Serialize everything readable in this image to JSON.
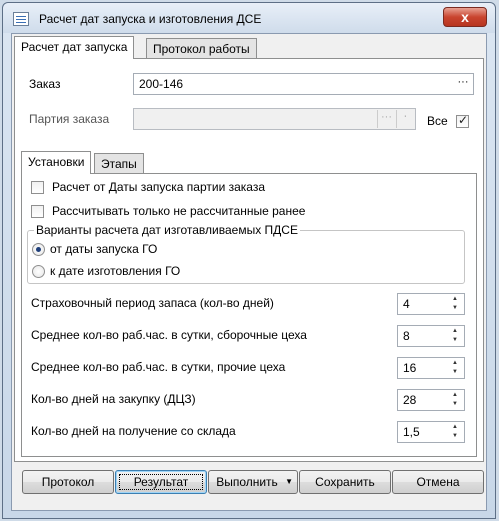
{
  "window": {
    "title": "Расчет дат запуска и изготовления ДСЕ",
    "close_glyph": "x"
  },
  "main_tabs": [
    {
      "label": "Расчет дат запуска",
      "active": true
    },
    {
      "label": "Протокол работы",
      "active": false
    }
  ],
  "order": {
    "label": "Заказ",
    "value": "200-146",
    "browse_glyph": "···"
  },
  "batch": {
    "label": "Партия заказа",
    "value": "",
    "browse_glyph": "···",
    "all_label": "Все",
    "all_checked": true,
    "all_mark": "✓"
  },
  "sub_tabs": [
    {
      "label": "Установки",
      "active": true
    },
    {
      "label": "Этапы",
      "active": false
    }
  ],
  "settings": {
    "option1": {
      "label": "Расчет от Даты запуска партии заказа",
      "checked": false
    },
    "option2": {
      "label": "Рассчитывать только не рассчитанные ранее",
      "checked": false
    },
    "variants": {
      "title": "Варианты расчета дат изготавливаемых ПДСЕ",
      "options": [
        {
          "label": "от даты запуска ГО",
          "selected": true
        },
        {
          "label": "к дате изготовления ГО",
          "selected": false
        }
      ]
    },
    "params": [
      {
        "label": "Страховочный период запаса (кол-во дней)",
        "value": "4"
      },
      {
        "label": "Среднее кол-во раб.час. в сутки, сборочные цеха",
        "value": "8"
      },
      {
        "label": "Среднее кол-во раб.час. в сутки, прочие цеха",
        "value": "16"
      },
      {
        "label": "Кол-во дней на закупку (ДЦЗ)",
        "value": "28"
      },
      {
        "label": "Кол-во дней на получение со склада",
        "value": "1,5"
      }
    ]
  },
  "buttons": {
    "protocol": "Протокол",
    "result": "Результат",
    "execute": "Выполнить",
    "execute_arrow": "▼",
    "save": "Сохранить",
    "cancel": "Отмена"
  },
  "spin_up_glyph": "▲",
  "spin_down_glyph": "▼"
}
